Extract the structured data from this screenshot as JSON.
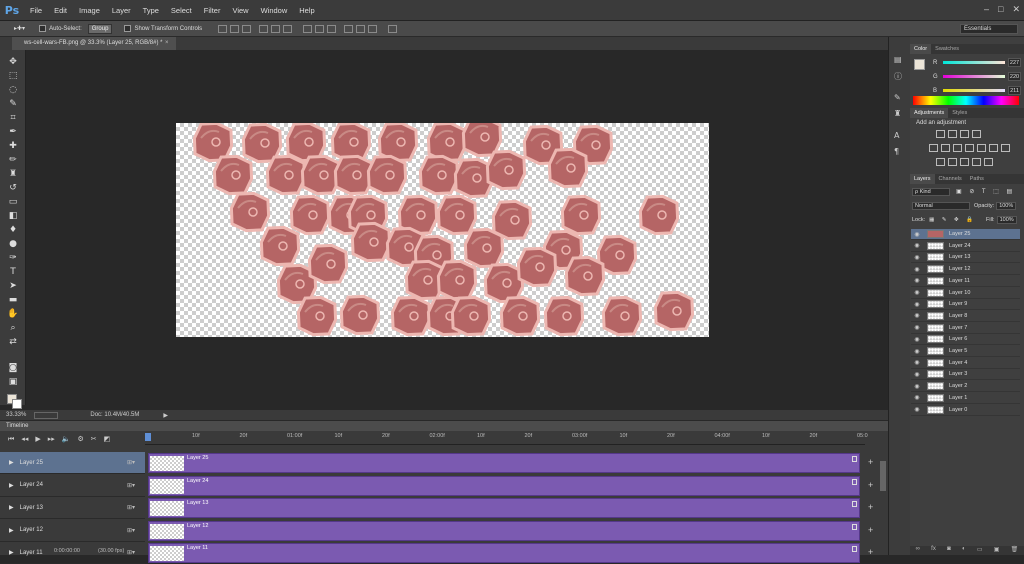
{
  "app": {
    "logo": "Ps",
    "menu": [
      "File",
      "Edit",
      "Image",
      "Layer",
      "Type",
      "Select",
      "Filter",
      "View",
      "Window",
      "Help"
    ],
    "window_controls": [
      "–",
      "□",
      "✕"
    ]
  },
  "options_bar": {
    "auto_select_label": "Auto-Select:",
    "auto_select_value": "Group",
    "show_transform_label": "Show Transform Controls",
    "workspace": "Essentials"
  },
  "document_tab": {
    "title": "ws-cell-wars-FB.png @ 33.3% (Layer 25, RGB/8#) *",
    "close": "×"
  },
  "status": {
    "zoom": "33.33%",
    "doc_info": "Doc: 10.4M/40.5M"
  },
  "colors": {
    "foreground": "#ece5d8",
    "cell_fill": "#b56565",
    "cell_outline": "#edb7b1",
    "clip_purple": "#7b5ab1",
    "selection_blue": "#5d7290"
  },
  "timeline": {
    "tab_label": "Timeline",
    "ruler_ticks": [
      "10f",
      "20f",
      "01:00f",
      "10f",
      "20f",
      "02:00f",
      "10f",
      "20f",
      "03:00f",
      "10f",
      "20f",
      "04:00f",
      "10f",
      "20f",
      "05:0"
    ],
    "current_time": "0:00:00:00",
    "fps": "(30.00 fps)",
    "tracks": [
      {
        "name": "Layer 25",
        "selected": true
      },
      {
        "name": "Layer 24",
        "selected": false
      },
      {
        "name": "Layer 13",
        "selected": false
      },
      {
        "name": "Layer 12",
        "selected": false
      },
      {
        "name": "Layer 11",
        "selected": false
      }
    ]
  },
  "color_panel": {
    "tabs": [
      "Color",
      "Swatches"
    ],
    "channels": [
      {
        "label": "R",
        "value": "227",
        "gradient": "linear-gradient(90deg,#00e5d8,#ffe5d8)"
      },
      {
        "label": "G",
        "value": "220",
        "gradient": "linear-gradient(90deg,#e300d8,#e3ffd8)"
      },
      {
        "label": "B",
        "value": "211",
        "gradient": "linear-gradient(90deg,#e3dc00,#e3dcff)"
      }
    ]
  },
  "adjustments_panel": {
    "tabs": [
      "Adjustments",
      "Styles"
    ],
    "title": "Add an adjustment"
  },
  "layers_panel": {
    "tabs": [
      "Layers",
      "Channels",
      "Paths"
    ],
    "kind_label": "ρ Kind",
    "blend_mode": "Normal",
    "opacity_label": "Opacity:",
    "opacity_value": "100%",
    "lock_label": "Lock:",
    "fill_label": "Fill:",
    "fill_value": "100%",
    "layers": [
      {
        "name": "Layer 25",
        "selected": true
      },
      {
        "name": "Layer 24",
        "selected": false
      },
      {
        "name": "Layer 13",
        "selected": false
      },
      {
        "name": "Layer 12",
        "selected": false
      },
      {
        "name": "Layer 11",
        "selected": false
      },
      {
        "name": "Layer 10",
        "selected": false
      },
      {
        "name": "Layer 9",
        "selected": false
      },
      {
        "name": "Layer 8",
        "selected": false
      },
      {
        "name": "Layer 7",
        "selected": false
      },
      {
        "name": "Layer 6",
        "selected": false
      },
      {
        "name": "Layer 5",
        "selected": false
      },
      {
        "name": "Layer 4",
        "selected": false
      },
      {
        "name": "Layer 3",
        "selected": false
      },
      {
        "name": "Layer 2",
        "selected": false
      },
      {
        "name": "Layer 1",
        "selected": false
      },
      {
        "name": "Layer 0",
        "selected": false
      }
    ]
  }
}
